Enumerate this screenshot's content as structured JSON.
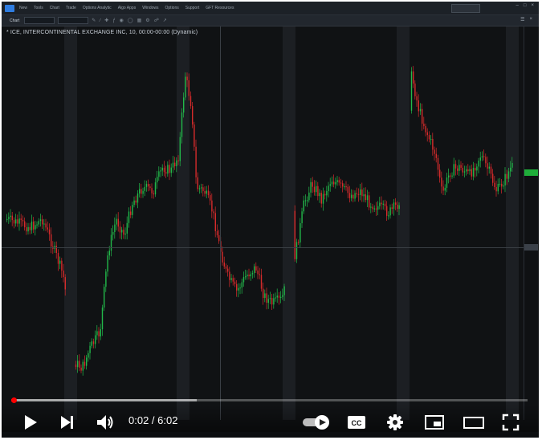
{
  "chart": {
    "title": "* ICE, INTERCONTINENTAL EXCHANGE INC, 10, 00:00-00:00 (Dynamic)"
  },
  "app": {
    "menu": [
      "New",
      "Tools",
      "Chart",
      "Trade",
      "Options Analytic",
      "Algo Apps",
      "Windows",
      "Options",
      "Support",
      "GFT Resources"
    ],
    "toolbar_tab": "Chart"
  },
  "player": {
    "current_time": "0:02",
    "separator": " / ",
    "duration": "6:02",
    "played_fraction": 0.005,
    "buffered_fraction": 0.36,
    "autoplay_on": true,
    "icons": [
      "play-icon",
      "next-icon",
      "volume-icon",
      "autoplay-toggle-icon",
      "captions-icon",
      "settings-icon",
      "miniplayer-icon",
      "theater-mode-icon",
      "fullscreen-icon"
    ],
    "cc_label": "CC"
  },
  "colors": {
    "up_candle": "#22b94a",
    "down_candle": "#d52b2b",
    "background": "#101214",
    "session_shade": "#1c1f23",
    "progress_red": "#ff0000"
  }
}
